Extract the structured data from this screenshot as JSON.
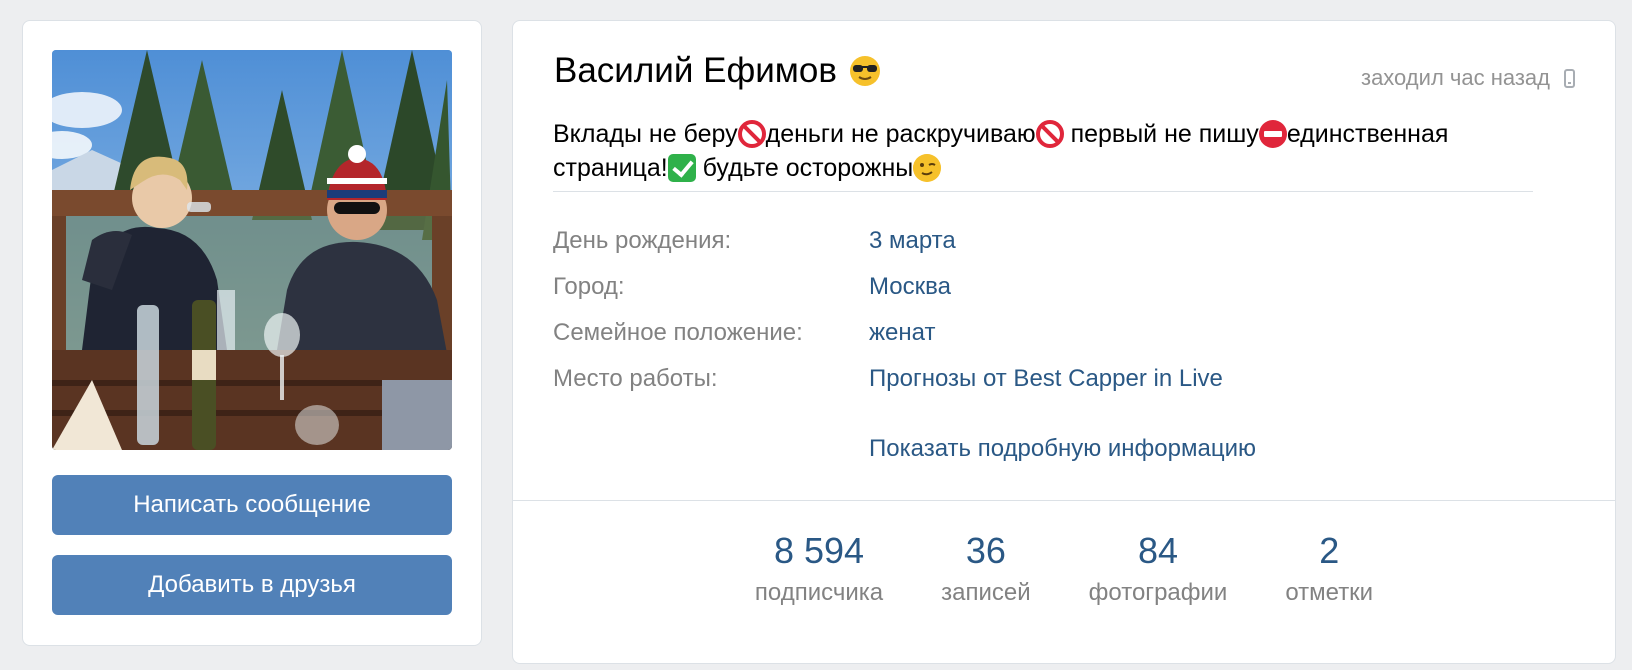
{
  "profile": {
    "name": "Василий Ефимов",
    "name_emoji": "cool-sunglasses-emoji",
    "online_status": "заходил час назад",
    "status_parts": [
      "Вклады не беру",
      "деньги не раскручиваю",
      " первый не пишу",
      "единственная страница!",
      " будьте осторожны"
    ]
  },
  "actions": {
    "message_label": "Написать сообщение",
    "add_friend_label": "Добавить в друзья"
  },
  "info": [
    {
      "label": "День рождения:",
      "value": "3 марта"
    },
    {
      "label": "Город:",
      "value": "Москва"
    },
    {
      "label": "Семейное положение:",
      "value": "женат"
    },
    {
      "label": "Место работы:",
      "value": "Прогнозы от Best Capper in Live"
    }
  ],
  "show_more_label": "Показать подробную информацию",
  "counters": [
    {
      "number": "8 594",
      "label": "подписчика"
    },
    {
      "number": "36",
      "label": "записей"
    },
    {
      "number": "84",
      "label": "фотографии"
    },
    {
      "number": "2",
      "label": "отметки"
    }
  ],
  "colors": {
    "accent": "#5181b8",
    "link": "#2a5885",
    "muted": "#828282",
    "background": "#edeef0"
  }
}
